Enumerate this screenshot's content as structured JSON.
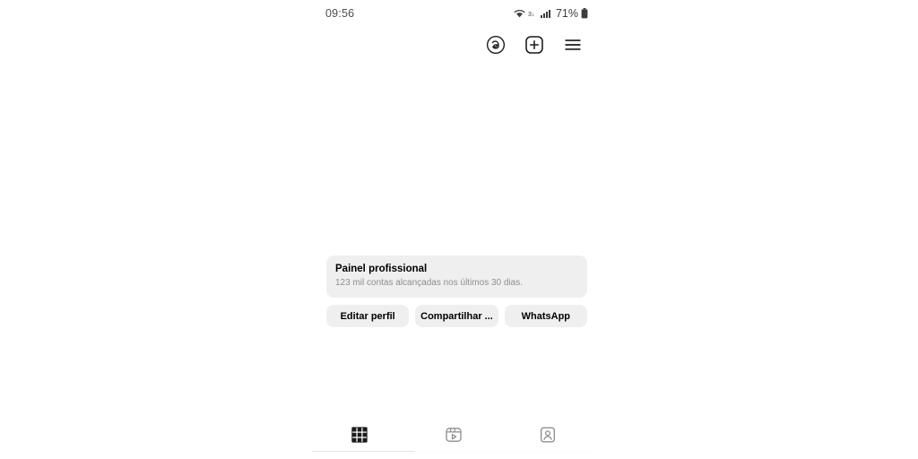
{
  "status_bar": {
    "time": "09:56",
    "battery_percent": "71%",
    "icons": [
      "wifi-icon",
      "mobile-data-icon",
      "signal-bars-icon",
      "battery-icon"
    ]
  },
  "top_nav": {
    "items": [
      {
        "name": "threads-icon",
        "label": "Threads"
      },
      {
        "name": "new-post-icon",
        "label": "Novo"
      },
      {
        "name": "menu-icon",
        "label": "Menu"
      }
    ]
  },
  "professional_dashboard": {
    "title": "Painel profissional",
    "subtitle": "123 mil contas alcançadas nos últimos 30 dias."
  },
  "actions": {
    "buttons": [
      {
        "name": "edit-profile-button",
        "label": "Editar perfil"
      },
      {
        "name": "share-profile-button",
        "label": "Compartilhar ..."
      },
      {
        "name": "whatsapp-button",
        "label": "WhatsApp"
      }
    ]
  },
  "tabs": {
    "items": [
      {
        "name": "tab-grid",
        "label": "Publicações",
        "active": true
      },
      {
        "name": "tab-reels",
        "label": "Reels",
        "active": false
      },
      {
        "name": "tab-tagged",
        "label": "Marcados",
        "active": false
      }
    ]
  },
  "colors": {
    "background": "#ffffff",
    "surface": "#efefef",
    "text_primary": "#000000",
    "text_secondary": "#8e8e8e"
  }
}
